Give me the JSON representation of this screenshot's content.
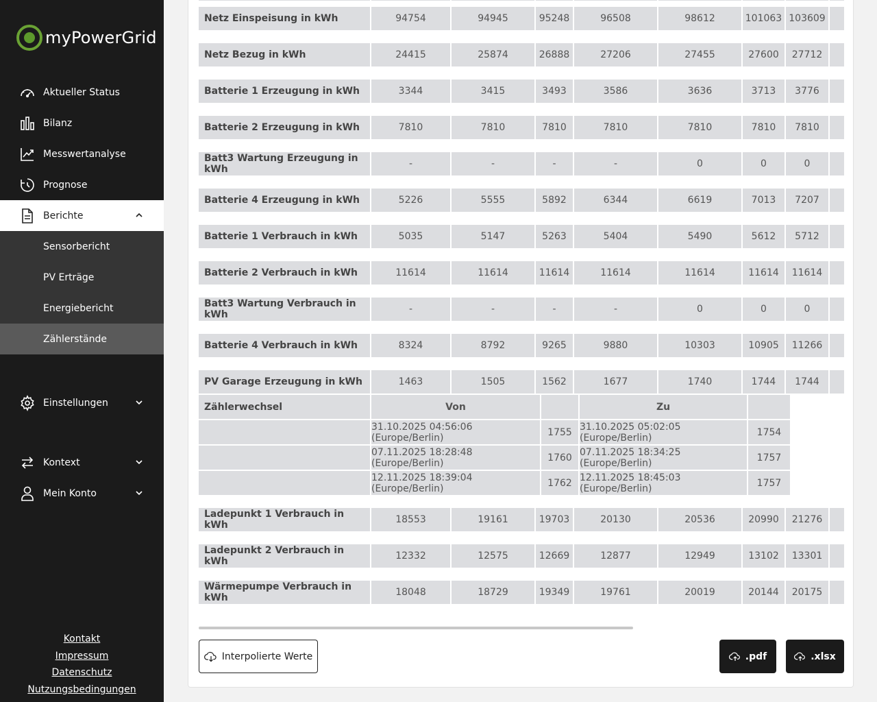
{
  "app": {
    "logo_text": "myPowerGrid"
  },
  "sidebar": {
    "items": [
      {
        "label": "Aktueller Status",
        "icon": "gauge-icon"
      },
      {
        "label": "Bilanz",
        "icon": "bar-chart-icon"
      },
      {
        "label": "Messwertanalyse",
        "icon": "line-chart-icon"
      },
      {
        "label": "Prognose",
        "icon": "clock-icon"
      },
      {
        "label": "Berichte",
        "icon": "document-icon",
        "expanded": true
      },
      {
        "label": "Einstellungen",
        "icon": "gear-icon"
      },
      {
        "label": "Kontext",
        "icon": "swap-arrows-icon"
      },
      {
        "label": "Mein Konto",
        "icon": "user-icon"
      }
    ],
    "berichte_sub": [
      "Sensorbericht",
      "PV Erträge",
      "Energiebericht",
      "Zählerstände"
    ],
    "active_sub": "Zählerstände",
    "footer": [
      "Kontakt",
      "Impressum",
      "Datenschutz",
      "Nutzungsbedingungen"
    ]
  },
  "table": {
    "rows": [
      {
        "label": "Netz Einspeisung in kWh",
        "values": [
          "94754",
          "94945",
          "95248",
          "96508",
          "98612",
          "101063",
          "103609"
        ]
      },
      {
        "label": "Netz Bezug in kWh",
        "values": [
          "24415",
          "25874",
          "26888",
          "27206",
          "27455",
          "27600",
          "27712"
        ]
      },
      {
        "label": "Batterie 1 Erzeugung in kWh",
        "values": [
          "3344",
          "3415",
          "3493",
          "3586",
          "3636",
          "3713",
          "3776"
        ]
      },
      {
        "label": "Batterie 2 Erzeugung in kWh",
        "values": [
          "7810",
          "7810",
          "7810",
          "7810",
          "7810",
          "7810",
          "7810"
        ]
      },
      {
        "label": "Batt3 Wartung Erzeugung in kWh",
        "values": [
          "-",
          "-",
          "-",
          "-",
          "0",
          "0",
          "0"
        ]
      },
      {
        "label": "Batterie 4 Erzeugung in kWh",
        "values": [
          "5226",
          "5555",
          "5892",
          "6344",
          "6619",
          "7013",
          "7207"
        ]
      },
      {
        "label": "Batterie 1 Verbrauch in kWh",
        "values": [
          "5035",
          "5147",
          "5263",
          "5404",
          "5490",
          "5612",
          "5712"
        ]
      },
      {
        "label": "Batterie 2 Verbrauch in kWh",
        "values": [
          "11614",
          "11614",
          "11614",
          "11614",
          "11614",
          "11614",
          "11614"
        ]
      },
      {
        "label": "Batt3 Wartung Verbrauch in kWh",
        "values": [
          "-",
          "-",
          "-",
          "-",
          "0",
          "0",
          "0"
        ]
      },
      {
        "label": "Batterie 4 Verbrauch in kWh",
        "values": [
          "8324",
          "8792",
          "9265",
          "9880",
          "10303",
          "10905",
          "11266"
        ]
      },
      {
        "label": "PV Garage Erzeugung in kWh",
        "values": [
          "1463",
          "1505",
          "1562",
          "1677",
          "1740",
          "1744",
          "1744"
        ]
      }
    ],
    "meter_change": {
      "label": "Zählerwechsel",
      "from_header": "Von",
      "to_header": "Zu",
      "entries": [
        {
          "from_time": "31.10.2025 04:56:06 (Europe/Berlin)",
          "from_value": "1755",
          "to_time": "31.10.2025 05:02:05 (Europe/Berlin)",
          "to_value": "1754"
        },
        {
          "from_time": "07.11.2025 18:28:48 (Europe/Berlin)",
          "from_value": "1760",
          "to_time": "07.11.2025 18:34:25 (Europe/Berlin)",
          "to_value": "1757"
        },
        {
          "from_time": "12.11.2025 18:39:04 (Europe/Berlin)",
          "from_value": "1762",
          "to_time": "12.11.2025 18:45:03 (Europe/Berlin)",
          "to_value": "1757"
        }
      ]
    },
    "rows_after": [
      {
        "label": "Ladepunkt 1 Verbrauch in kWh",
        "values": [
          "18553",
          "19161",
          "19703",
          "20130",
          "20536",
          "20990",
          "21276"
        ]
      },
      {
        "label": "Ladepunkt 2 Verbrauch in kWh",
        "values": [
          "12332",
          "12575",
          "12669",
          "12877",
          "12949",
          "13102",
          "13301"
        ]
      },
      {
        "label": "Wärmepumpe Verbrauch in kWh",
        "values": [
          "18048",
          "18729",
          "19349",
          "19761",
          "20019",
          "20144",
          "20175"
        ]
      }
    ]
  },
  "buttons": {
    "interpolated": "Interpolierte Werte",
    "pdf": ".pdf",
    "xlsx": ".xlsx"
  }
}
